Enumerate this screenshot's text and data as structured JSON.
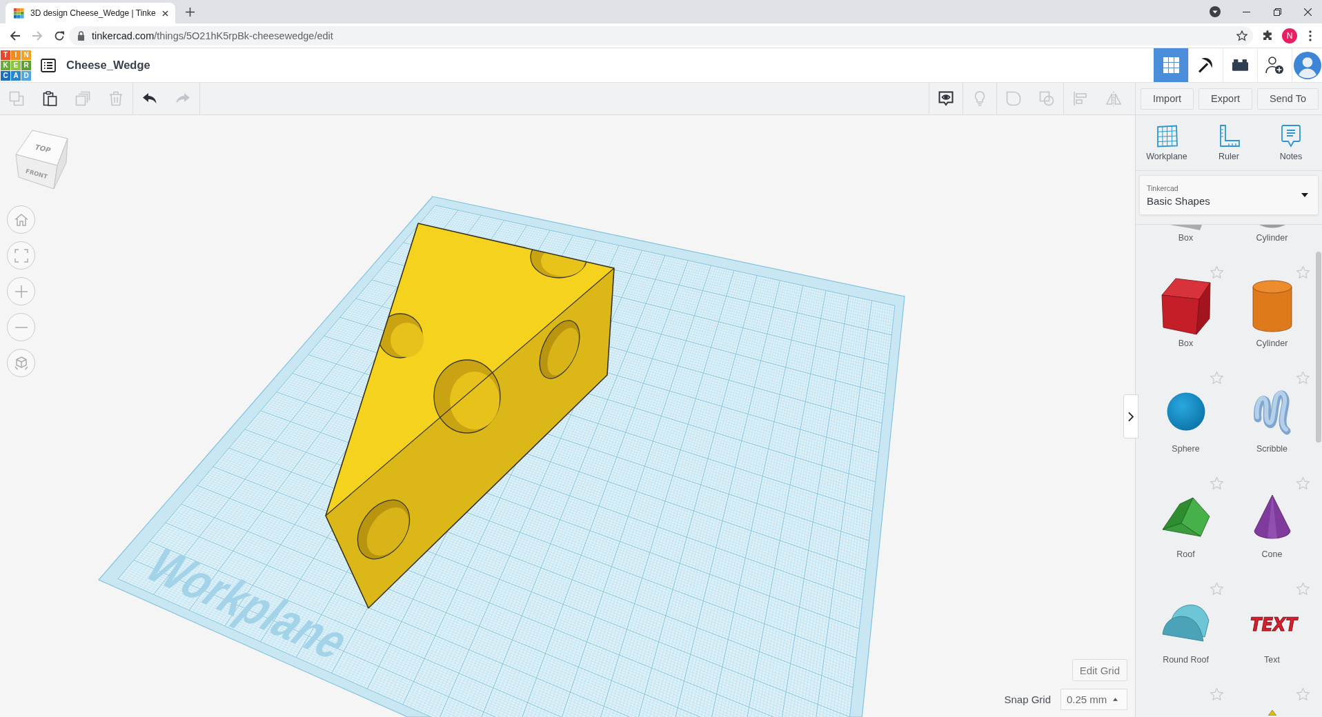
{
  "browser": {
    "tab_title": "3D design Cheese_Wedge | Tinke",
    "url_host": "tinkercad.com",
    "url_path": "/things/5O21hK5rpBk-cheesewedge/edit",
    "profile_initial": "N"
  },
  "header": {
    "logo": [
      {
        "letter": "T",
        "color": "#e8472a"
      },
      {
        "letter": "I",
        "color": "#f08c1e"
      },
      {
        "letter": "N",
        "color": "#f5a01f"
      },
      {
        "letter": "K",
        "color": "#6aac3c"
      },
      {
        "letter": "E",
        "color": "#8cc342"
      },
      {
        "letter": "R",
        "color": "#5d9e35"
      },
      {
        "letter": "C",
        "color": "#1a6fbf"
      },
      {
        "letter": "A",
        "color": "#2587d2"
      },
      {
        "letter": "D",
        "color": "#4fa6e2"
      }
    ],
    "design_title": "Cheese_Wedge",
    "views": [
      {
        "kind": "grid",
        "selected": true
      },
      {
        "kind": "pickaxe",
        "selected": false
      },
      {
        "kind": "bricks",
        "selected": false
      }
    ]
  },
  "toolbar": {
    "left_groups": [
      {
        "tools": [
          {
            "kind": "copy",
            "disabled": true
          },
          {
            "kind": "paste",
            "disabled": false
          },
          {
            "kind": "duplicate",
            "disabled": true
          },
          {
            "kind": "delete",
            "disabled": true
          }
        ]
      },
      {
        "tools": [
          {
            "kind": "undo",
            "disabled": false
          },
          {
            "kind": "redo",
            "disabled": true
          }
        ]
      }
    ],
    "right_groups": [
      {
        "tools": [
          {
            "kind": "notes",
            "disabled": false
          }
        ]
      },
      {
        "tools": [
          {
            "kind": "bulb",
            "disabled": true
          }
        ]
      },
      {
        "tools": [
          {
            "kind": "group",
            "disabled": true
          },
          {
            "kind": "subtract",
            "disabled": true
          }
        ]
      },
      {
        "tools": [
          {
            "kind": "align",
            "disabled": true
          },
          {
            "kind": "mirror",
            "disabled": true
          }
        ]
      }
    ],
    "actions": [
      "Import",
      "Export",
      "Send To"
    ]
  },
  "canvas": {
    "view_cube": {
      "top": "TOP",
      "front": "FRONT"
    },
    "nav_buttons": [
      {
        "kind": "home"
      },
      {
        "kind": "fit"
      },
      {
        "kind": "zoomin"
      },
      {
        "kind": "zoomout"
      },
      {
        "kind": "ortho"
      }
    ],
    "workplane_label": "Workplane",
    "edit_grid": "Edit Grid",
    "snap_grid": {
      "label": "Snap Grid",
      "value": "0.25 mm"
    }
  },
  "panel": {
    "tools": [
      {
        "kind": "workplane",
        "label": "Workplane"
      },
      {
        "kind": "ruler",
        "label": "Ruler"
      },
      {
        "kind": "notes",
        "label": "Notes"
      }
    ],
    "library": {
      "provider": "Tinkercad",
      "category": "Basic Shapes"
    },
    "shape_rows": [
      {
        "shapes": [
          {
            "kind": "boxhole",
            "label": "Box"
          },
          {
            "kind": "cylinderhole",
            "label": "Cylinder"
          }
        ]
      },
      {
        "shapes": [
          {
            "kind": "box",
            "label": "Box",
            "favorite": false
          },
          {
            "kind": "cylinder",
            "label": "Cylinder",
            "favorite": false
          }
        ]
      },
      {
        "shapes": [
          {
            "kind": "sphere",
            "label": "Sphere",
            "favorite": false
          },
          {
            "kind": "scribble",
            "label": "Scribble",
            "favorite": false
          }
        ]
      },
      {
        "shapes": [
          {
            "kind": "roof",
            "label": "Roof",
            "favorite": false
          },
          {
            "kind": "cone",
            "label": "Cone",
            "favorite": false
          }
        ]
      },
      {
        "shapes": [
          {
            "kind": "roundroof",
            "label": "Round Roof",
            "favorite": false
          },
          {
            "kind": "text",
            "label": "Text",
            "thumbnail_text": "TEXT",
            "favorite": false
          }
        ]
      },
      {
        "shapes": [
          {
            "kind": "blank",
            "favorite": false
          },
          {
            "kind": "pyramid",
            "favorite": false
          }
        ]
      }
    ]
  }
}
